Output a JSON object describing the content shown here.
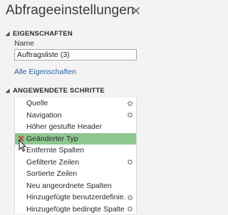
{
  "pane": {
    "title": "Abfrageeinstellungen",
    "close_icon": "close-icon"
  },
  "properties": {
    "header": "EIGENSCHAFTEN",
    "name_label": "Name",
    "name_value": "Auftragsliste (3)",
    "all_properties_link": "Alle Eigenschaften"
  },
  "steps": {
    "header": "ANGEWENDETE SCHRITTE",
    "items": [
      {
        "label": "Quelle",
        "gear": true,
        "selected": false
      },
      {
        "label": "Navigation",
        "gear": true,
        "selected": false
      },
      {
        "label": "Höher gestufte Header",
        "gear": false,
        "selected": false
      },
      {
        "label": "Geänderter Typ",
        "gear": false,
        "selected": true
      },
      {
        "label": "Entfernte Spalten",
        "gear": false,
        "selected": false
      },
      {
        "label": "Gefilterte Zeilen",
        "gear": true,
        "selected": false
      },
      {
        "label": "Sortierte Zeilen",
        "gear": false,
        "selected": false
      },
      {
        "label": "Neu angeordnete Spalten",
        "gear": false,
        "selected": false
      },
      {
        "label": "Hinzugefügte benutzerdefinie...",
        "gear": true,
        "selected": false
      },
      {
        "label": "Hinzugefügte bedingte Spalte",
        "gear": true,
        "selected": false
      }
    ]
  },
  "colors": {
    "selected_row": "#8fc690",
    "link": "#2e5fa3",
    "delete": "#c0392b"
  }
}
